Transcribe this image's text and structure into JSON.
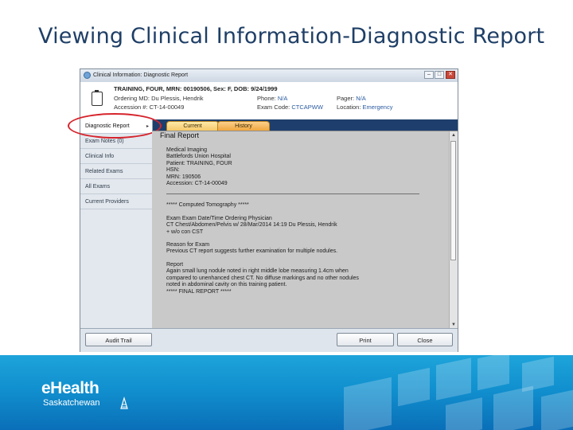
{
  "slide": {
    "title": "Viewing Clinical Information-Diagnostic Report"
  },
  "window": {
    "title": "Clinical Information: Diagnostic Report",
    "controls": [
      "–",
      "□",
      "✕"
    ]
  },
  "patient": {
    "header": "TRAINING, FOUR, MRN: 00190506, Sex: F, DOB: 9/24/1999",
    "ordering_md_label": "Ordering MD:",
    "ordering_md_value": "Du Plessis, Hendrik",
    "accession_label": "Accession #:",
    "accession_value": "CT-14-00049",
    "phone_label": "Phone:",
    "phone_value": "N/A",
    "exam_code_label": "Exam Code:",
    "exam_code_value": "CTCAPWW",
    "pager_label": "Pager:",
    "pager_value": "N/A",
    "location_label": "Location:",
    "location_value": "Emergency"
  },
  "tabs": {
    "current": "Current",
    "history": "History"
  },
  "sidebar": {
    "items": [
      {
        "label": "Diagnostic Report",
        "arrow": "▸"
      },
      {
        "label": "Exam Notes (0)"
      },
      {
        "label": "Clinical Info"
      },
      {
        "label": "Related Exams"
      },
      {
        "label": "All Exams"
      },
      {
        "label": "Current Providers"
      }
    ]
  },
  "report": {
    "heading": "Final Report",
    "facility": [
      "Medical Imaging",
      "Battlefords Union Hospital",
      "Patient: TRAINING, FOUR",
      "HSN:",
      "MRN: 190506",
      "Accession: CT-14-00049"
    ],
    "modality": "***** Computed Tomography *****",
    "exam": [
      "Exam Exam Date/Time Ordering Physician",
      "CT Chest/Abdomen/Pelvis w/ 28/Mar/2014 14:19 Du Plessis, Hendrik",
      "+ w/o con CST"
    ],
    "reason": [
      "Reason for Exam",
      "Previous CT report suggests further examination for multiple nodules."
    ],
    "findings": [
      "Report",
      "Again small lung nodule noted in right middle lobe measuring 1.4cm when",
      "compared to unenhanced chest CT. No diffuse markings and no other nodules",
      "noted in abdominal cavity on this training patient.",
      "***** FINAL REPORT *****"
    ]
  },
  "buttons": {
    "audit_trail": "Audit Trail",
    "print": "Print",
    "close": "Close"
  },
  "footer": {
    "logo_main": "eHealth",
    "logo_sub": "Saskatchewan"
  },
  "colors": {
    "title_blue": "#1f3f66",
    "tab_bar": "#1e3f6e",
    "annotation_red": "#d6242c",
    "footer_blue": "#1190cf"
  }
}
